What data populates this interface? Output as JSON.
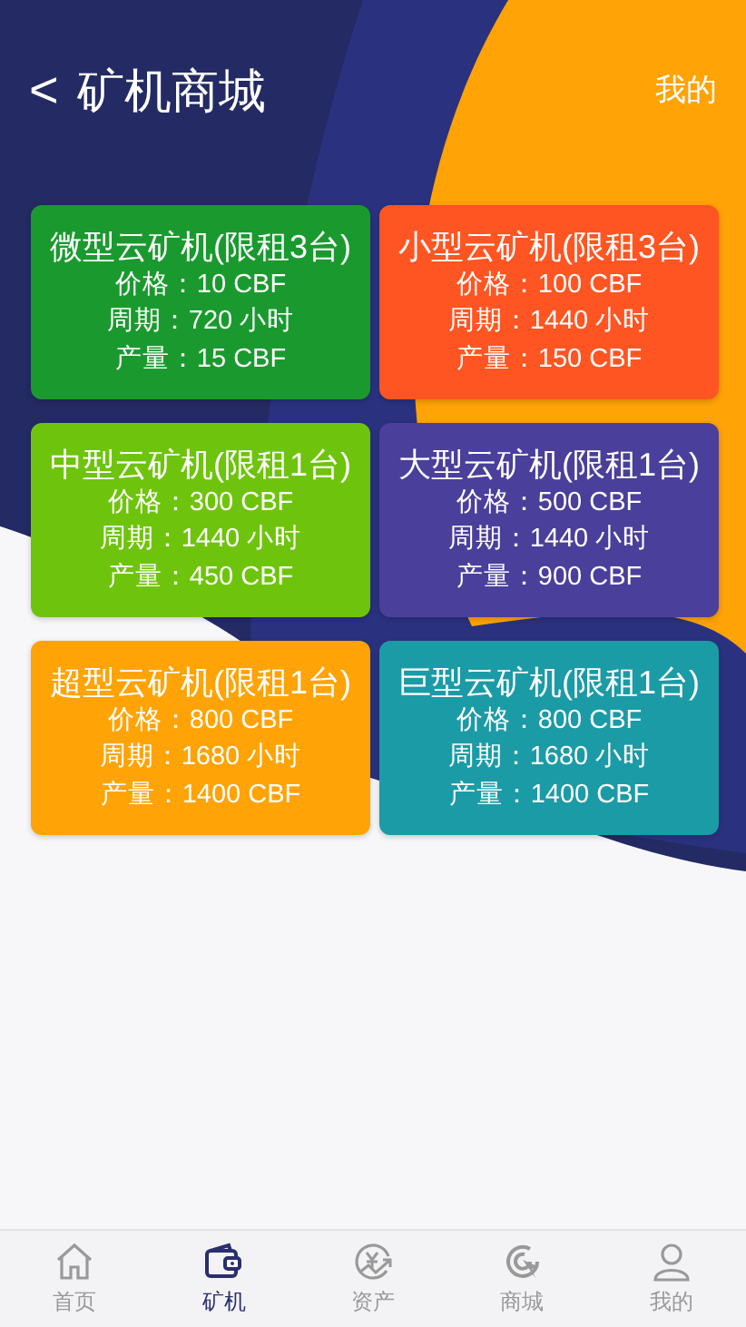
{
  "header": {
    "back": "<",
    "title": "矿机商城",
    "action": "我的"
  },
  "machines": [
    {
      "name": "微型云矿机(限租3台)",
      "price": "价格：10 CBF",
      "cycle": "周期：720 小时",
      "output": "产量：15 CBF",
      "color": "#1a9a2e"
    },
    {
      "name": "小型云矿机(限租3台)",
      "price": "价格：100 CBF",
      "cycle": "周期：1440 小时",
      "output": "产量：150 CBF",
      "color": "#ff5522"
    },
    {
      "name": "中型云矿机(限租1台)",
      "price": "价格：300 CBF",
      "cycle": "周期：1440 小时",
      "output": "产量：450 CBF",
      "color": "#6ec40c"
    },
    {
      "name": "大型云矿机(限租1台)",
      "price": "价格：500 CBF",
      "cycle": "周期：1440 小时",
      "output": "产量：900 CBF",
      "color": "#4a3f9a"
    },
    {
      "name": "超型云矿机(限租1台)",
      "price": "价格：800 CBF",
      "cycle": "周期：1680 小时",
      "output": "产量：1400 CBF",
      "color": "#ffa306"
    },
    {
      "name": "巨型云矿机(限租1台)",
      "price": "价格：800 CBF",
      "cycle": "周期：1680 小时",
      "output": "产量：1400 CBF",
      "color": "#1b9ba6"
    }
  ],
  "tabbar": [
    {
      "kind": "home",
      "label": "首页",
      "selected": false
    },
    {
      "kind": "wallet",
      "label": "矿机",
      "selected": true
    },
    {
      "kind": "assets",
      "label": "资产",
      "selected": false
    },
    {
      "kind": "shop",
      "label": "商城",
      "selected": false
    },
    {
      "kind": "user",
      "label": "我的",
      "selected": false
    }
  ]
}
